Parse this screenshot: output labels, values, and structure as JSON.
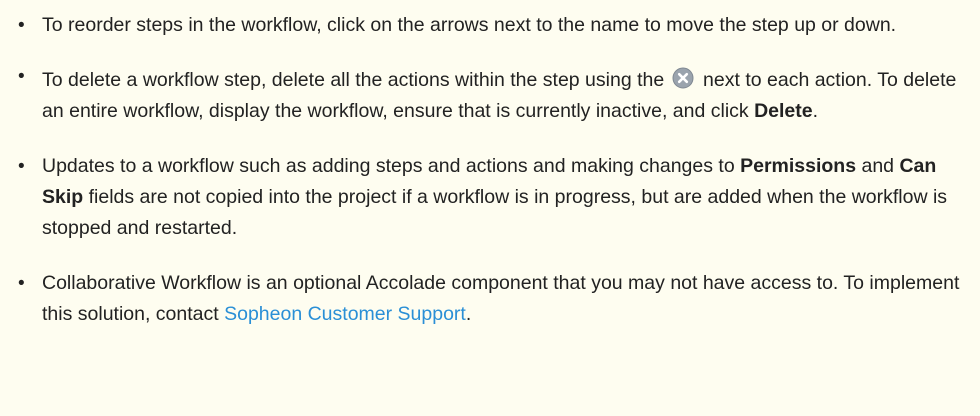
{
  "bullet_glyph": "•",
  "items": [
    {
      "text": "To reorder steps in the workflow, click on the arrows next to the name to move the step up or down."
    },
    {
      "before_icon": "To delete a workflow step, delete all the actions within the step using the",
      "icon": "delete-circle-icon",
      "after_icon": "next to each action. To delete an entire workflow, display the workflow, ensure that is currently inactive, and click ",
      "bold": "Delete",
      "end": "."
    },
    {
      "part1": "Updates to a workflow such as adding steps and actions and making changes to ",
      "bold1": "Permissions",
      "part2": " and ",
      "bold2": "Can Skip",
      "part3": " fields are not copied into the project if a workflow is in progress, but are added when the workflow is stopped and restarted."
    },
    {
      "before_link": "Collaborative Workflow is an optional Accolade component that you may not have access to. To implement this solution, contact ",
      "link": "Sopheon Customer Support",
      "end": "."
    }
  ],
  "colors": {
    "background": "#fefdf0",
    "text": "#222222",
    "link": "#2a8fd6",
    "icon_fill": "#9aa3ad"
  }
}
